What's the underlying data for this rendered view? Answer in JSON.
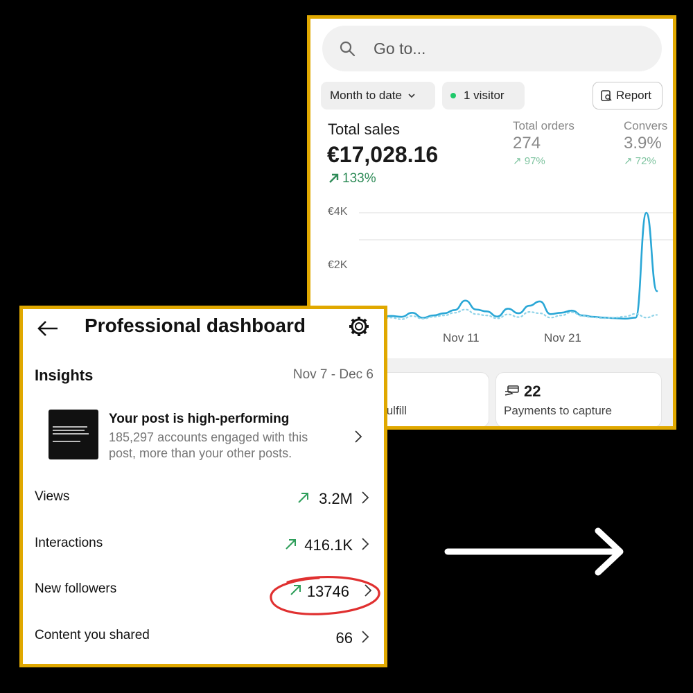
{
  "shop": {
    "search_placeholder": "Go to...",
    "date_filter": "Month to date",
    "visitors": "1 visitor",
    "report_label": "Report",
    "total_sales": {
      "title": "Total sales",
      "value": "€17,028.16",
      "change": "133%"
    },
    "total_orders": {
      "title": "Total orders",
      "value": "274",
      "change": "97%"
    },
    "conversion": {
      "title": "Convers",
      "value": "3.9%",
      "change": "72%"
    },
    "chart_data": {
      "type": "line",
      "y_ticks": [
        "€4K",
        "€2K"
      ],
      "x_ticks": [
        "Nov 11",
        "Nov 21"
      ],
      "ylim": [
        0,
        4500
      ],
      "series": [
        {
          "values": [
            130,
            330,
            120,
            180,
            150,
            300,
            110,
            200,
            280,
            400,
            750,
            420,
            350,
            160,
            450,
            280,
            560,
            720,
            250,
            300,
            380,
            200,
            150,
            120,
            100,
            80,
            120,
            4000,
            1100
          ]
        },
        {
          "values": [
            300,
            100,
            60,
            120,
            60,
            180,
            80,
            150,
            200,
            300,
            420,
            250,
            200,
            90,
            240,
            140,
            330,
            280,
            120,
            200,
            320,
            180,
            130,
            100,
            120,
            160,
            260,
            120,
            220
          ]
        }
      ],
      "colors": [
        "#2aa7d6",
        "#8fd3e8"
      ],
      "grid": true
    },
    "cards": [
      {
        "label": "fulfill"
      },
      {
        "count": "22",
        "label": "Payments to capture"
      }
    ]
  },
  "ig": {
    "title": "Professional dashboard",
    "insights_label": "Insights",
    "date_range": "Nov 7 - Dec 6",
    "post": {
      "title": "Your post is high-performing",
      "desc": "185,297 accounts engaged with this post, more than your other posts."
    },
    "rows": [
      {
        "label": "Views",
        "value": "3.2M",
        "trend": "up"
      },
      {
        "label": "Interactions",
        "value": "416.1K",
        "trend": "up"
      },
      {
        "label": "New followers",
        "value": "13746",
        "trend": "up"
      },
      {
        "label": "Content you shared",
        "value": "66",
        "trend": "none"
      }
    ],
    "accent_up": "#2e9e5a",
    "highlight": "#e03030"
  },
  "colors": {
    "frame": "#e0a800",
    "background": "#000000"
  }
}
